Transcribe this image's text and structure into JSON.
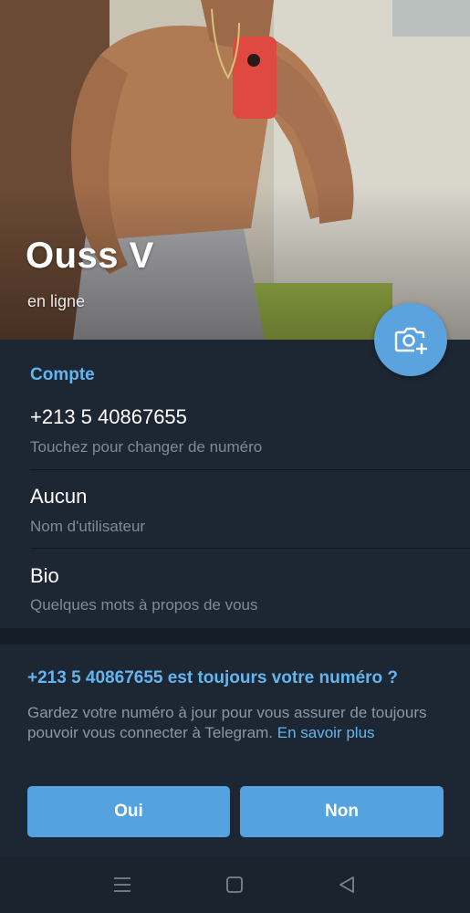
{
  "profile": {
    "name": "Ouss V",
    "status": "en ligne"
  },
  "account": {
    "section_title": "Compte",
    "phone": {
      "value": "+213 5 40867655",
      "hint": "Touchez pour changer de numéro"
    },
    "username": {
      "value": "Aucun",
      "hint": "Nom d'utilisateur"
    },
    "bio": {
      "value": "Bio",
      "hint": "Quelques mots à propos de vous"
    }
  },
  "suggestion": {
    "title": "+213 5 40867655 est toujours votre numéro ?",
    "text": "Gardez votre numéro à jour pour vous assurer de toujours pouvoir vous connecter à Telegram.",
    "link": "En savoir plus",
    "yes_label": "Oui",
    "no_label": "Non"
  },
  "icons": {
    "camera": "add-photo-icon",
    "nav_menu": "menu-icon",
    "nav_home": "home-square-icon",
    "nav_back": "back-triangle-icon"
  },
  "colors": {
    "accent": "#64b5ef",
    "button": "#54a2e0",
    "background": "#1d2733"
  }
}
